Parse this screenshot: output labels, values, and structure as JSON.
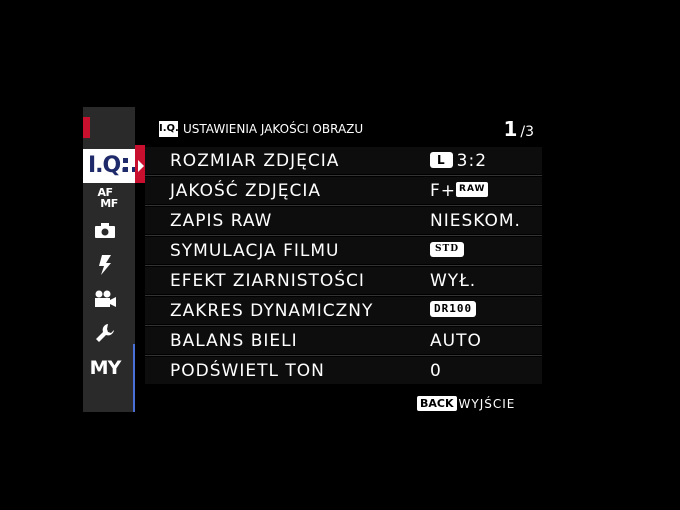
{
  "header": {
    "tab_badge": "I.Q.",
    "title": "USTAWIENIA JAKOŚCI OBRAZU",
    "page_current": "1",
    "page_total": "/3"
  },
  "tabs": [
    {
      "label": "I.Q.",
      "active": true
    },
    {
      "label": "AF",
      "sub": "MF"
    },
    {
      "label": "camera-icon"
    },
    {
      "label": "flash-icon"
    },
    {
      "label": "movie-camera-icon"
    },
    {
      "label": "wrench-icon"
    },
    {
      "label": "MY"
    }
  ],
  "menu": [
    {
      "label": "ROZMIAR ZDJĘCIA",
      "badge": "L",
      "value": "3:2"
    },
    {
      "label": "JAKOŚĆ ZDJĘCIA",
      "value": "F+",
      "badge": "RAW"
    },
    {
      "label": "ZAPIS RAW",
      "value": "NIESKOM."
    },
    {
      "label": "SYMULACJA FILMU",
      "badge": "STD"
    },
    {
      "label": "EFEKT ZIARNISTOŚCI",
      "value": "WYŁ."
    },
    {
      "label": "ZAKRES DYNAMICZNY",
      "badge": "DR100"
    },
    {
      "label": "BALANS BIELI",
      "value": "AUTO"
    },
    {
      "label": "PODŚWIETL TON",
      "value": "0"
    }
  ],
  "footer": {
    "back_badge": "BACK",
    "exit_label": "WYJŚCIE"
  },
  "colors": {
    "accent_red": "#c8102e",
    "tab_navy": "#1f2a6b",
    "indicator_blue": "#4a6fd6"
  }
}
